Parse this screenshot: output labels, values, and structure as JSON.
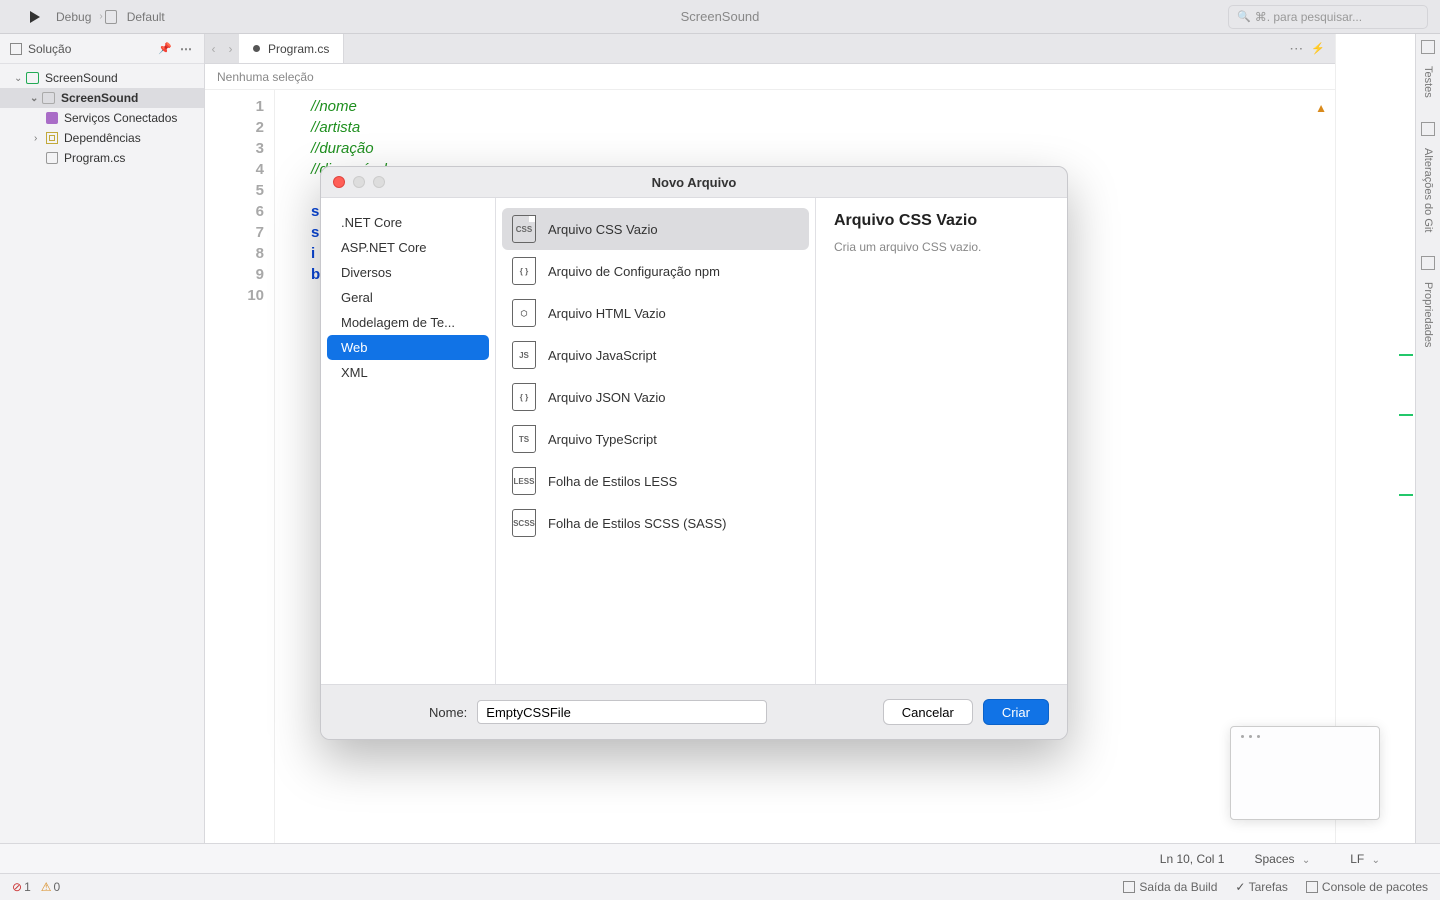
{
  "toolbar": {
    "config": "Debug",
    "target_icon": "device-icon",
    "target": "Default",
    "title": "ScreenSound",
    "search_placeholder": "⌘. para pesquisar..."
  },
  "sidebar": {
    "title": "Solução",
    "tree": {
      "solution": "ScreenSound",
      "project": "ScreenSound",
      "connected_services": "Serviços Conectados",
      "dependencies": "Dependências",
      "program_file": "Program.cs"
    }
  },
  "editor": {
    "tab": "Program.cs",
    "breadcrumb": "Nenhuma seleção",
    "lines": [
      {
        "n": "1",
        "cls": "cm-comment",
        "t": "//nome"
      },
      {
        "n": "2",
        "cls": "cm-comment",
        "t": "//artista"
      },
      {
        "n": "3",
        "cls": "cm-comment",
        "t": "//duração"
      },
      {
        "n": "4",
        "cls": "cm-comment",
        "t": "//disponível"
      },
      {
        "n": "5",
        "cls": "",
        "t": ""
      },
      {
        "n": "6",
        "cls": "cm-kw",
        "t": "s"
      },
      {
        "n": "7",
        "cls": "cm-kw",
        "t": "s"
      },
      {
        "n": "8",
        "cls": "cm-kw",
        "t": "i"
      },
      {
        "n": "9",
        "cls": "cm-kw",
        "t": "b"
      },
      {
        "n": "10",
        "cls": "",
        "t": ""
      }
    ],
    "footer": {
      "pos": "Ln 10, Col 1",
      "indent": "Spaces",
      "eol": "LF"
    }
  },
  "right_rails": [
    "Testes",
    "Alterações do Git",
    "Propriedades"
  ],
  "status": {
    "errors": "1",
    "warnings": "0",
    "build_output": "Saída da Build",
    "tasks": "Tarefas",
    "packages": "Console de pacotes"
  },
  "modal": {
    "title": "Novo Arquivo",
    "categories": [
      ".NET Core",
      "ASP.NET Core",
      "Diversos",
      "Geral",
      "Modelagem de Te...",
      "Web",
      "XML"
    ],
    "selected_category": "Web",
    "templates": [
      {
        "label": "Arquivo CSS Vazio",
        "badge": "CSS",
        "selected": true
      },
      {
        "label": "Arquivo de Configuração npm",
        "badge": "{ }",
        "selected": false
      },
      {
        "label": "Arquivo HTML Vazio",
        "badge": "⬡",
        "selected": false
      },
      {
        "label": "Arquivo JavaScript",
        "badge": "JS",
        "selected": false
      },
      {
        "label": "Arquivo JSON Vazio",
        "badge": "{ }",
        "selected": false
      },
      {
        "label": "Arquivo TypeScript",
        "badge": "TS",
        "selected": false
      },
      {
        "label": "Folha de Estilos LESS",
        "badge": "LESS",
        "selected": false
      },
      {
        "label": "Folha de Estilos SCSS (SASS)",
        "badge": "SCSS",
        "selected": false
      }
    ],
    "detail": {
      "title": "Arquivo CSS Vazio",
      "desc": "Cria um arquivo CSS vazio."
    },
    "name_label": "Nome:",
    "name_value": "EmptyCSSFile",
    "cancel": "Cancelar",
    "create": "Criar"
  }
}
